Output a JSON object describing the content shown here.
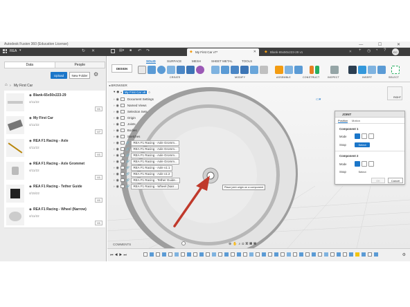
{
  "window": {
    "title": "Autodesk Fusion 360 (Education License)",
    "controls": "—  ☐  ✕"
  },
  "appbar": {
    "team": "REA",
    "file_tabs": [
      {
        "label": "My First Car v7*",
        "active": true
      },
      {
        "label": "Blank-65x50x223-29 v1",
        "active": false
      }
    ],
    "user_initials": "EC"
  },
  "data_panel": {
    "tabs": [
      "Data",
      "People"
    ],
    "upload_label": "Upload",
    "new_folder_label": "New Folder",
    "project_title": "My First Car",
    "items": [
      {
        "name": "Blank-65x50x223-29",
        "date": "4/11/22",
        "version": "V1"
      },
      {
        "name": "My First Car",
        "date": "4/11/22",
        "version": "V7"
      },
      {
        "name": "REA F1 Racing - Axle",
        "date": "4/11/22",
        "version": "V1"
      },
      {
        "name": "REA F1 Racing - Axle Grommet",
        "date": "4/11/22",
        "version": "V1"
      },
      {
        "name": "REA F1 Racing - Tether Guide",
        "date": "4/15/22",
        "version": "V1"
      },
      {
        "name": "REA F1 Racing - Wheel (Narrow)",
        "date": "4/11/22",
        "version": "V1"
      }
    ]
  },
  "toolbar": {
    "design_label": "DESIGN",
    "tabs": [
      "SOLID",
      "SURFACE",
      "MESH",
      "SHEET METAL",
      "TOOLS"
    ],
    "active_tab": "SOLID",
    "groups": [
      "CREATE",
      "MODIFY",
      "ASSEMBLE",
      "CONSTRUCT",
      "INSPECT",
      "INSERT",
      "SELECT"
    ]
  },
  "browser": {
    "title": "BROWSER",
    "root": "My First Car v8",
    "nodes": [
      "Document Settings",
      "Named Views",
      "Selection Sets",
      "Origin",
      "Joints",
      "Bodies",
      "Sketches",
      "REA F1 Racing - Axle Gromm...",
      "REA F1 Racing - Axle Gromm...",
      "REA F1 Racing - Axle Gromm...",
      "REA F1 Racing - Axle Gromm...",
      "REA F1 Racing - Axle v1:1",
      "REA F1 Racing - Axle v1:2",
      "REA F1 Racing - Tether Guide...",
      "REA F1 Racing - Wheel (Narr..."
    ]
  },
  "tooltip": "Place joint origin on a component",
  "viewcube": {
    "face": "RIGHT"
  },
  "joint_dialog": {
    "title": "JOINT",
    "tabs": [
      "Position",
      "Motion"
    ],
    "component1": {
      "header": "Component 1",
      "mode_label": "Mode",
      "snap_label": "Snap",
      "select_label": "Select"
    },
    "component2": {
      "header": "Component 2",
      "mode_label": "Mode",
      "snap_label": "Snap",
      "select_label": "Select"
    },
    "ok_label": "OK",
    "cancel_label": "Cancel"
  },
  "comments": {
    "label": "COMMENTS"
  },
  "colors": {
    "accent": "#1b76c9",
    "arrow": "#c0392b",
    "appbar": "#3c3c3c"
  }
}
